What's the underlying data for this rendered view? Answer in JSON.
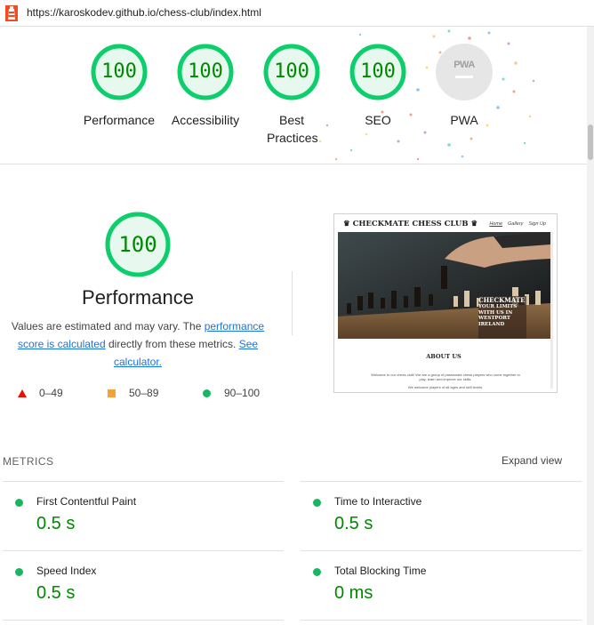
{
  "browser": {
    "url": "https://karoskodev.github.io/chess-club/index.html"
  },
  "colors": {
    "pass": "#0cce6b",
    "pass_text": "#008800",
    "fail": "#eb0f00",
    "average": "#f4a13a",
    "link": "#1a73e8"
  },
  "gauges": [
    {
      "label": "Performance",
      "score": "100"
    },
    {
      "label": "Accessibility",
      "score": "100"
    },
    {
      "label": "Best Practices",
      "score": "100"
    },
    {
      "label": "SEO",
      "score": "100"
    },
    {
      "label": "PWA",
      "badge_text": "PWA"
    }
  ],
  "performance": {
    "score": "100",
    "title": "Performance",
    "desc_pre": "Values are estimated and may vary. The ",
    "desc_link1": "performance score is calculated",
    "desc_mid": " directly from these metrics. ",
    "desc_link2": "See calculator.",
    "legend": [
      {
        "icon": "triangle-icon",
        "range": "0–49"
      },
      {
        "icon": "square-icon",
        "range": "50–89"
      },
      {
        "icon": "circle-icon",
        "range": "90–100"
      }
    ]
  },
  "screenshot": {
    "site_title": "CHECKMATE CHESS CLUB",
    "nav": [
      "Home",
      "Gallery",
      "Sign Up"
    ],
    "hero_lines": [
      "CHECKMATE",
      "YOUR LIMITS",
      "WITH US IN",
      "WESTPORT",
      "IRELAND"
    ],
    "about_heading": "ABOUT US",
    "about_text": "Welcome to our chess club! We are a group of passionate chess players who come together to play, learn and improve our skills.",
    "about_text2": "We welcome players of all ages and skill levels."
  },
  "metrics": {
    "header": "METRICS",
    "expand_label": "Expand view",
    "items": [
      {
        "label": "First Contentful Paint",
        "value": "0.5 s"
      },
      {
        "label": "Time to Interactive",
        "value": "0.5 s"
      },
      {
        "label": "Speed Index",
        "value": "0.5 s"
      },
      {
        "label": "Total Blocking Time",
        "value": "0 ms"
      }
    ]
  }
}
